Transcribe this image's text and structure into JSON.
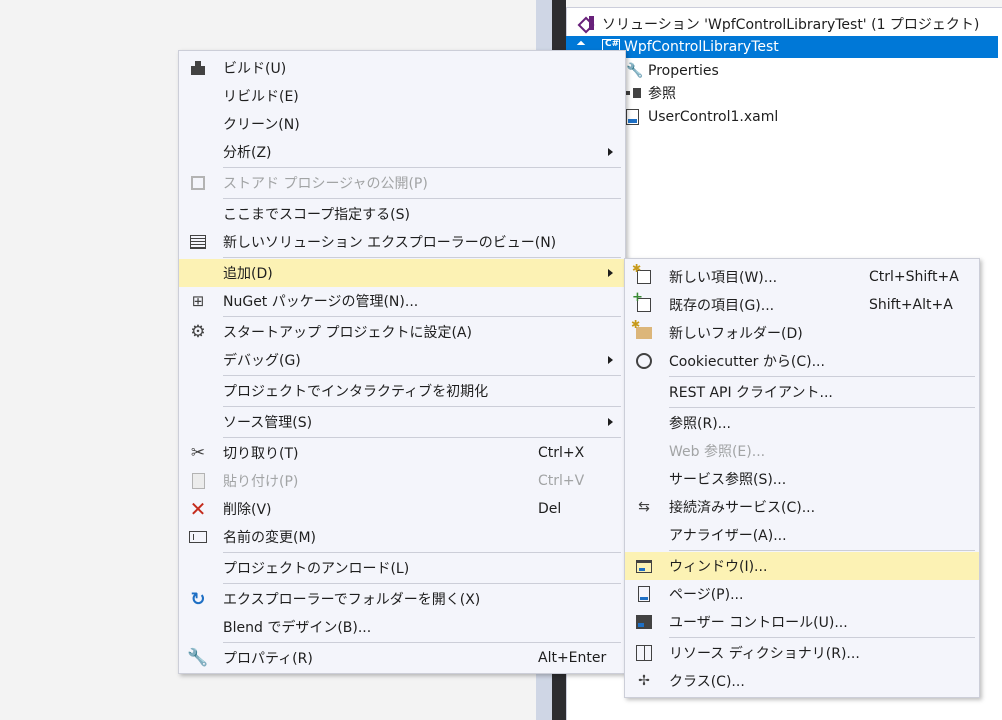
{
  "solution_explorer": {
    "solution_label": "ソリューション 'WpfControlLibraryTest' (1 プロジェクト)",
    "project_label": "WpfControlLibraryTest",
    "items": [
      {
        "label": "Properties",
        "icon": "wrench-icon"
      },
      {
        "label": "参照",
        "icon": "references-icon"
      },
      {
        "label": "UserControl1.xaml",
        "icon": "xaml-file-icon"
      }
    ]
  },
  "context_menu": {
    "items": [
      {
        "label": "ビルド(U)",
        "icon": "build-icon"
      },
      {
        "label": "リビルド(E)"
      },
      {
        "label": "クリーン(N)"
      },
      {
        "label": "分析(Z)",
        "submenu": true
      },
      {
        "label": "ストアド プロシージャの公開(P)",
        "disabled": true,
        "icon": "publish-icon"
      },
      {
        "label": "ここまでスコープ指定する(S)"
      },
      {
        "label": "新しいソリューション エクスプローラーのビュー(N)",
        "icon": "new-view-icon"
      },
      {
        "label": "追加(D)",
        "submenu": true,
        "highlighted": true
      },
      {
        "label": "NuGet パッケージの管理(N)...",
        "icon": "nuget-icon"
      },
      {
        "label": "スタートアップ プロジェクトに設定(A)",
        "icon": "gear-icon"
      },
      {
        "label": "デバッグ(G)",
        "submenu": true
      },
      {
        "label": "プロジェクトでインタラクティブを初期化"
      },
      {
        "label": "ソース管理(S)",
        "submenu": true
      },
      {
        "label": "切り取り(T)",
        "shortcut": "Ctrl+X",
        "icon": "scissors-icon"
      },
      {
        "label": "貼り付け(P)",
        "shortcut": "Ctrl+V",
        "disabled": true,
        "icon": "paste-icon"
      },
      {
        "label": "削除(V)",
        "shortcut": "Del",
        "icon": "delete-icon"
      },
      {
        "label": "名前の変更(M)",
        "icon": "rename-icon"
      },
      {
        "label": "プロジェクトのアンロード(L)"
      },
      {
        "label": "エクスプローラーでフォルダーを開く(X)",
        "icon": "refresh-icon"
      },
      {
        "label": "Blend でデザイン(B)..."
      },
      {
        "label": "プロパティ(R)",
        "shortcut": "Alt+Enter",
        "icon": "wrench-icon"
      }
    ]
  },
  "add_submenu": {
    "items": [
      {
        "label": "新しい項目(W)...",
        "shortcut": "Ctrl+Shift+A",
        "icon": "new-item-icon"
      },
      {
        "label": "既存の項目(G)...",
        "shortcut": "Shift+Alt+A",
        "icon": "existing-item-icon"
      },
      {
        "label": "新しいフォルダー(D)",
        "icon": "new-folder-icon"
      },
      {
        "label": "Cookiecutter から(C)...",
        "icon": "cookie-icon"
      },
      {
        "label": "REST API クライアント..."
      },
      {
        "label": "参照(R)..."
      },
      {
        "label": "Web 参照(E)...",
        "disabled": true
      },
      {
        "label": "サービス参照(S)..."
      },
      {
        "label": "接続済みサービス(C)...",
        "icon": "connected-service-icon"
      },
      {
        "label": "アナライザー(A)..."
      },
      {
        "label": "ウィンドウ(I)...",
        "highlighted": true,
        "icon": "window-icon"
      },
      {
        "label": "ページ(P)...",
        "icon": "page-icon"
      },
      {
        "label": "ユーザー コントロール(U)...",
        "icon": "user-control-icon"
      },
      {
        "label": "リソース ディクショナリ(R)...",
        "icon": "resource-dictionary-icon"
      },
      {
        "label": "クラス(C)...",
        "icon": "class-icon"
      }
    ]
  }
}
